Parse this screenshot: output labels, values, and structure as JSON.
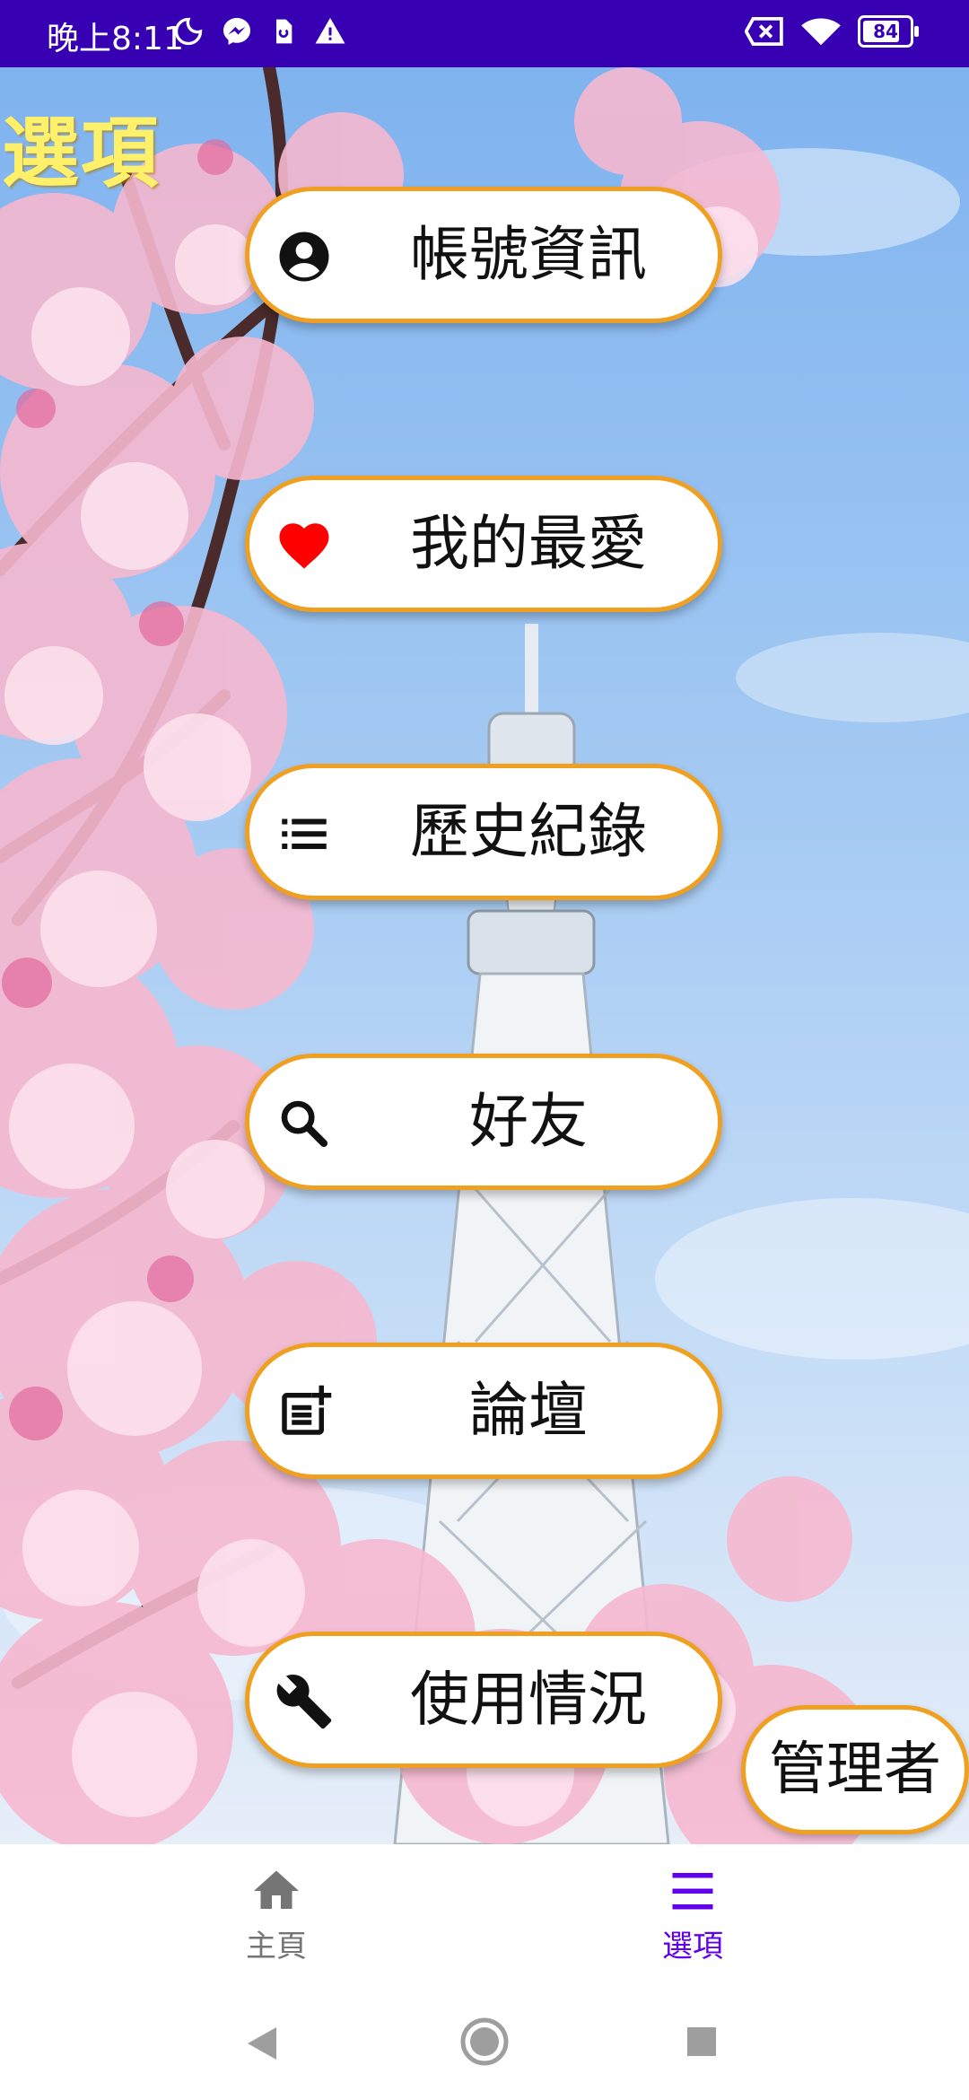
{
  "status_bar": {
    "time": "晚上8:11",
    "battery": "84",
    "icons_left": [
      "moon-icon",
      "messenger-icon",
      "sim-icon",
      "warning-icon"
    ],
    "icons_right": [
      "close-box-icon",
      "wifi-icon",
      "battery-icon"
    ]
  },
  "page": {
    "title": "選項"
  },
  "menu": {
    "items": [
      {
        "label": "帳號資訊",
        "icon": "account-circle-icon"
      },
      {
        "label": "我的最愛",
        "icon": "heart-icon"
      },
      {
        "label": "歷史紀錄",
        "icon": "list-icon"
      },
      {
        "label": "好友",
        "icon": "search-icon"
      },
      {
        "label": "論壇",
        "icon": "post-add-icon"
      },
      {
        "label": "使用情況",
        "icon": "wrench-icon"
      }
    ],
    "admin_label": "管理者"
  },
  "bottom_nav": {
    "home_label": "主頁",
    "options_label": "選項",
    "active": "選項"
  },
  "colors": {
    "status_bar": "#3700b3",
    "accent": "#6200ee",
    "button_border": "#f0a020",
    "title": "#fff06a",
    "heart": "#ff0000"
  }
}
